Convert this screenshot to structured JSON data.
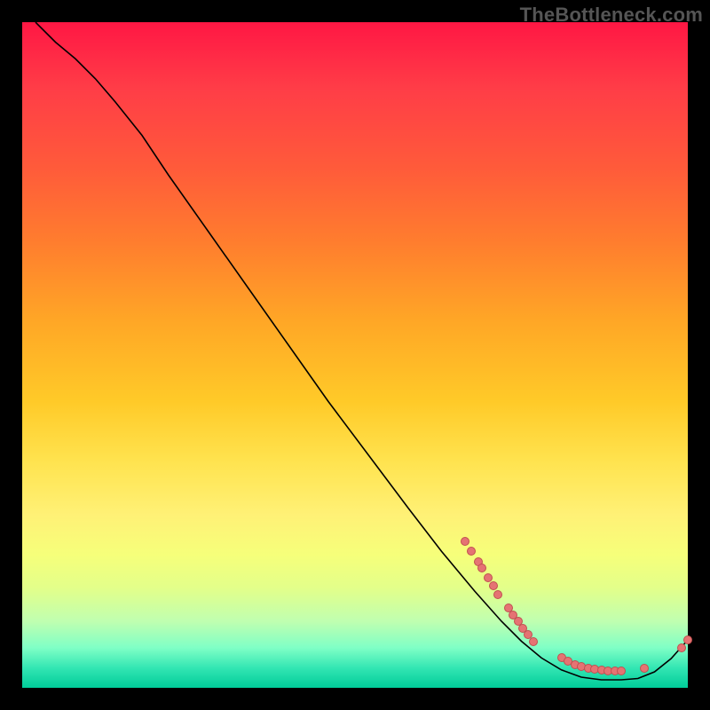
{
  "watermark": "TheBottleneck.com",
  "colors": {
    "curve": "#000000",
    "point_fill": "#e57373",
    "point_stroke": "#c05050"
  },
  "chart_data": {
    "type": "line",
    "title": "",
    "xlabel": "",
    "ylabel": "",
    "xlim": [
      0,
      100
    ],
    "ylim": [
      0,
      100
    ],
    "curve": [
      {
        "x": 2.0,
        "y": 100.0
      },
      {
        "x": 5.0,
        "y": 97.0
      },
      {
        "x": 8.0,
        "y": 94.5
      },
      {
        "x": 11.0,
        "y": 91.5
      },
      {
        "x": 14.0,
        "y": 88.0
      },
      {
        "x": 18.0,
        "y": 83.0
      },
      {
        "x": 22.0,
        "y": 77.0
      },
      {
        "x": 28.0,
        "y": 68.5
      },
      {
        "x": 34.0,
        "y": 60.0
      },
      {
        "x": 40.0,
        "y": 51.5
      },
      {
        "x": 46.0,
        "y": 43.0
      },
      {
        "x": 52.0,
        "y": 35.0
      },
      {
        "x": 58.0,
        "y": 27.0
      },
      {
        "x": 63.0,
        "y": 20.5
      },
      {
        "x": 68.0,
        "y": 14.5
      },
      {
        "x": 72.0,
        "y": 10.0
      },
      {
        "x": 75.0,
        "y": 7.0
      },
      {
        "x": 78.0,
        "y": 4.5
      },
      {
        "x": 81.0,
        "y": 2.7
      },
      {
        "x": 84.0,
        "y": 1.6
      },
      {
        "x": 87.0,
        "y": 1.2
      },
      {
        "x": 90.0,
        "y": 1.2
      },
      {
        "x": 92.5,
        "y": 1.4
      },
      {
        "x": 95.0,
        "y": 2.4
      },
      {
        "x": 97.5,
        "y": 4.4
      },
      {
        "x": 100.0,
        "y": 7.2
      }
    ],
    "points": [
      {
        "x": 66.5,
        "y": 22.0
      },
      {
        "x": 67.5,
        "y": 20.5
      },
      {
        "x": 68.5,
        "y": 19.0
      },
      {
        "x": 69.0,
        "y": 18.0
      },
      {
        "x": 70.0,
        "y": 16.5
      },
      {
        "x": 70.8,
        "y": 15.3
      },
      {
        "x": 71.5,
        "y": 14.0
      },
      {
        "x": 73.0,
        "y": 12.0
      },
      {
        "x": 73.7,
        "y": 11.0
      },
      {
        "x": 74.5,
        "y": 10.0
      },
      {
        "x": 75.2,
        "y": 9.0
      },
      {
        "x": 76.0,
        "y": 8.0
      },
      {
        "x": 76.8,
        "y": 7.0
      },
      {
        "x": 81.0,
        "y": 4.5
      },
      {
        "x": 82.0,
        "y": 4.0
      },
      {
        "x": 83.0,
        "y": 3.5
      },
      {
        "x": 84.0,
        "y": 3.2
      },
      {
        "x": 85.0,
        "y": 3.0
      },
      {
        "x": 86.0,
        "y": 2.8
      },
      {
        "x": 87.0,
        "y": 2.7
      },
      {
        "x": 88.0,
        "y": 2.6
      },
      {
        "x": 89.0,
        "y": 2.6
      },
      {
        "x": 90.0,
        "y": 2.6
      },
      {
        "x": 93.5,
        "y": 3.0
      },
      {
        "x": 99.0,
        "y": 6.0
      },
      {
        "x": 100.0,
        "y": 7.2
      }
    ]
  }
}
